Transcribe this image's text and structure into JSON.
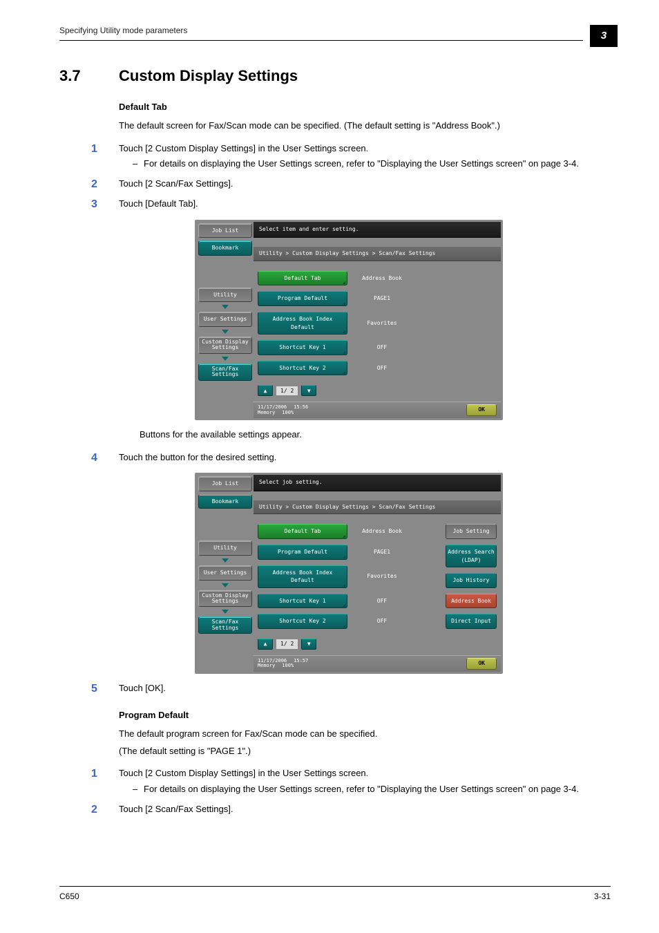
{
  "runhead": {
    "title": "Specifying Utility mode parameters",
    "chapter_no": "3"
  },
  "heading": {
    "num": "3.7",
    "title": "Custom Display Settings"
  },
  "sectA": {
    "subhead": "Default Tab",
    "desc": "The default screen for Fax/Scan mode can be specified. (The default setting is \"Address Book\".)",
    "steps": [
      {
        "no": "1",
        "text": "Touch [2 Custom Display Settings] in the User Settings screen.",
        "dash": "For details on displaying the User Settings screen, refer to \"Displaying the User Settings screen\" on page 3-4."
      },
      {
        "no": "2",
        "text": "Touch [2 Scan/Fax Settings]."
      },
      {
        "no": "3",
        "text": "Touch [Default Tab]."
      }
    ],
    "mid_line": "Buttons for the available settings appear.",
    "step4": {
      "no": "4",
      "text": "Touch the button for the desired setting."
    },
    "step5": {
      "no": "5",
      "text": "Touch [OK]."
    }
  },
  "panel1": {
    "topbar": "Select item and enter setting.",
    "crumb": "Utility > Custom Display Settings > Scan/Fax Settings",
    "rows": [
      {
        "k": "Default Tab",
        "ksel": true,
        "v": "Address Book"
      },
      {
        "k": "Program Default",
        "v": "PAGE1"
      },
      {
        "k": "Address Book Index Default",
        "v": "Favorites"
      },
      {
        "k": "Shortcut Key 1",
        "v": "OFF"
      },
      {
        "k": "Shortcut Key 2",
        "v": "OFF"
      }
    ],
    "pager": "1/ 2",
    "date": "11/17/2006",
    "time": "15:56",
    "mem": "Memory",
    "memv": "100%",
    "ok": "OK",
    "side": [
      "Job List",
      "Bookmark",
      "Utility",
      "User Settings",
      "Custom Display Settings",
      "Scan/Fax Settings"
    ]
  },
  "panel2": {
    "topbar": "Select job setting.",
    "crumb": "Utility > Custom Display Settings > Scan/Fax Settings",
    "rows": [
      {
        "k": "Default Tab",
        "ksel": true,
        "v": "Address Book"
      },
      {
        "k": "Program Default",
        "v": "PAGE1"
      },
      {
        "k": "Address Book Index Default",
        "v": "Favorites"
      },
      {
        "k": "Shortcut Key 1",
        "v": "OFF"
      },
      {
        "k": "Shortcut Key 2",
        "v": "OFF"
      }
    ],
    "rcol": [
      {
        "label": "Job Setting",
        "cls": "grey"
      },
      {
        "label": "Address Search (LDAP)",
        "cls": ""
      },
      {
        "label": "Job History",
        "cls": ""
      },
      {
        "label": "Address Book",
        "cls": "red"
      },
      {
        "label": "Direct Input",
        "cls": ""
      }
    ],
    "pager": "1/ 2",
    "date": "11/17/2006",
    "time": "15:57",
    "mem": "Memory",
    "memv": "100%",
    "ok": "OK",
    "side": [
      "Job List",
      "Bookmark",
      "Utility",
      "User Settings",
      "Custom Display Settings",
      "Scan/Fax Settings"
    ]
  },
  "sectB": {
    "subhead": "Program Default",
    "desc1": "The default program screen for Fax/Scan mode can be specified.",
    "desc2": "(The default setting is \"PAGE 1\".)",
    "steps": [
      {
        "no": "1",
        "text": "Touch [2 Custom Display Settings] in the User Settings screen.",
        "dash": "For details on displaying the User Settings screen, refer to \"Displaying the User Settings screen\" on page 3-4."
      },
      {
        "no": "2",
        "text": "Touch [2 Scan/Fax Settings]."
      }
    ]
  },
  "footer": {
    "left": "C650",
    "right": "3-31"
  }
}
